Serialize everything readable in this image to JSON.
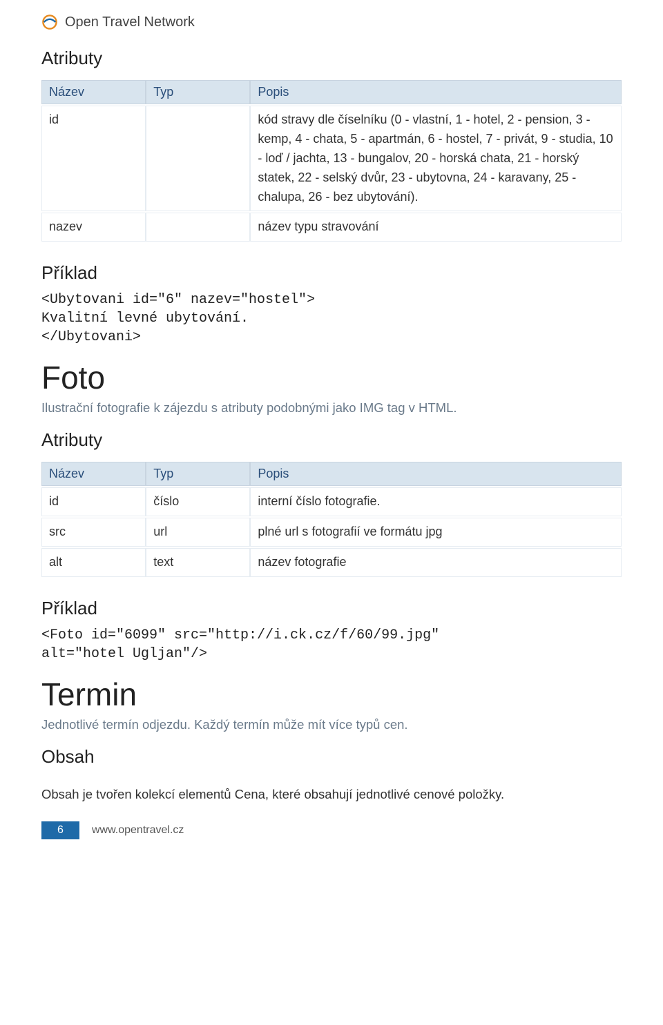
{
  "brand": "Open Travel Network",
  "sections": {
    "atributy1": {
      "title": "Atributy",
      "headers": {
        "name": "Název",
        "type": "Typ",
        "desc": "Popis"
      },
      "rows": [
        {
          "name": "id",
          "type": "",
          "desc": "kód stravy dle číselníku (0 - vlastní, 1 - hotel, 2 - pension, 3 - kemp, 4 - chata, 5 - apartmán, 6 - hostel, 7 - privát, 9 - studia, 10 - loď / jachta, 13 - bungalov, 20 - horská chata, 21 - horský statek, 22 - selský dvůr, 23 - ubytovna, 24 - karavany, 25 - chalupa, 26 - bez ubytování)."
        },
        {
          "name": "nazev",
          "type": "",
          "desc": "název typu stravování"
        }
      ]
    },
    "priklad1": {
      "title": "Příklad",
      "code": "<Ubytovani id=\"6\" nazev=\"hostel\">\nKvalitní levné ubytování.\n</Ubytovani>"
    },
    "foto": {
      "title": "Foto",
      "lead": "Ilustrační fotografie k zájezdu s atributy podobnými jako IMG tag v HTML."
    },
    "atributy2": {
      "title": "Atributy",
      "headers": {
        "name": "Název",
        "type": "Typ",
        "desc": "Popis"
      },
      "rows": [
        {
          "name": "id",
          "type": "číslo",
          "desc": "interní číslo fotografie."
        },
        {
          "name": "src",
          "type": "url",
          "desc": "plné url s fotografií ve formátu jpg"
        },
        {
          "name": "alt",
          "type": "text",
          "desc": "název fotografie"
        }
      ]
    },
    "priklad2": {
      "title": "Příklad",
      "code": "<Foto id=\"6099\" src=\"http://i.ck.cz/f/60/99.jpg\"\nalt=\"hotel Ugljan\"/>"
    },
    "termin": {
      "title": "Termin",
      "lead": "Jednotlivé termín odjezdu. Každý termín může mít více typů cen."
    },
    "obsah": {
      "title": "Obsah",
      "body": "Obsah je tvořen kolekcí elementů Cena, které obsahují jednotlivé cenové položky."
    }
  },
  "footer": {
    "page": "6",
    "url": "www.opentravel.cz"
  }
}
